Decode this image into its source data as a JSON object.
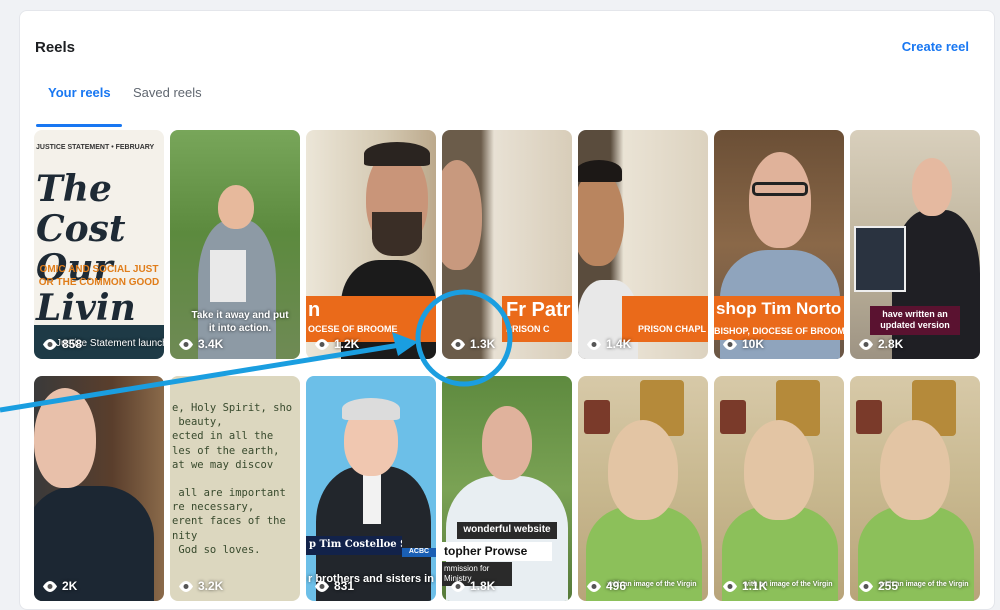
{
  "section": {
    "title": "Reels",
    "create_label": "Create reel"
  },
  "tabs": [
    {
      "label": "Your reels",
      "active": true
    },
    {
      "label": "Saved reels",
      "active": false
    }
  ],
  "reels": [
    {
      "views": "858",
      "caption": "Justice Statement launch event live",
      "top_text": "JUSTICE STATEMENT • FEBRUARY",
      "big_text": "The Cost Our Livin",
      "sub_text": "OMIC AND SOCIAL JUST OR THE COMMON GOOD"
    },
    {
      "views": "3.4K",
      "caption": "Take it away and put it into action."
    },
    {
      "views": "1.2K",
      "banner": "n",
      "banner_sub": "OCESE OF BROOME"
    },
    {
      "views": "1.3K",
      "banner": "Fr Patr",
      "banner_sub": "PRISON C"
    },
    {
      "views": "1.4K",
      "banner_sub": "PRISON CHAPL"
    },
    {
      "views": "10K",
      "banner": "shop Tim Norto",
      "banner_sub": "BISHOP, DIOCESE OF BROOME"
    },
    {
      "views": "2.8K",
      "caption": "have written an updated version"
    },
    {
      "views": "2K"
    },
    {
      "views": "3.2K",
      "body_text": "e, Holy Spirit, sho\n beauty,\nected in all the\nles of the earth,\nat we may discov\n\n all are important\nre necessary,\nerent faces of the\nnity\n God so loves."
    },
    {
      "views": "831",
      "name_text": "p Tim Costelloe SDB",
      "tag": "ACBC",
      "caption": "r brothers and sisters in"
    },
    {
      "views": "1.8K",
      "caption_top": "wonderful website",
      "name_text": "topher Prowse",
      "sub_text": "mmission for Ministry"
    },
    {
      "views": "496",
      "caption": "with an image of the Virgin"
    },
    {
      "views": "1.1K",
      "caption": "with an image of the Virgin"
    },
    {
      "views": "255",
      "caption": "with an image of the Virgin"
    }
  ],
  "colors": {
    "accent": "#1877f2",
    "banner": "#ea6a1a",
    "annotation": "#1a9ee0"
  }
}
